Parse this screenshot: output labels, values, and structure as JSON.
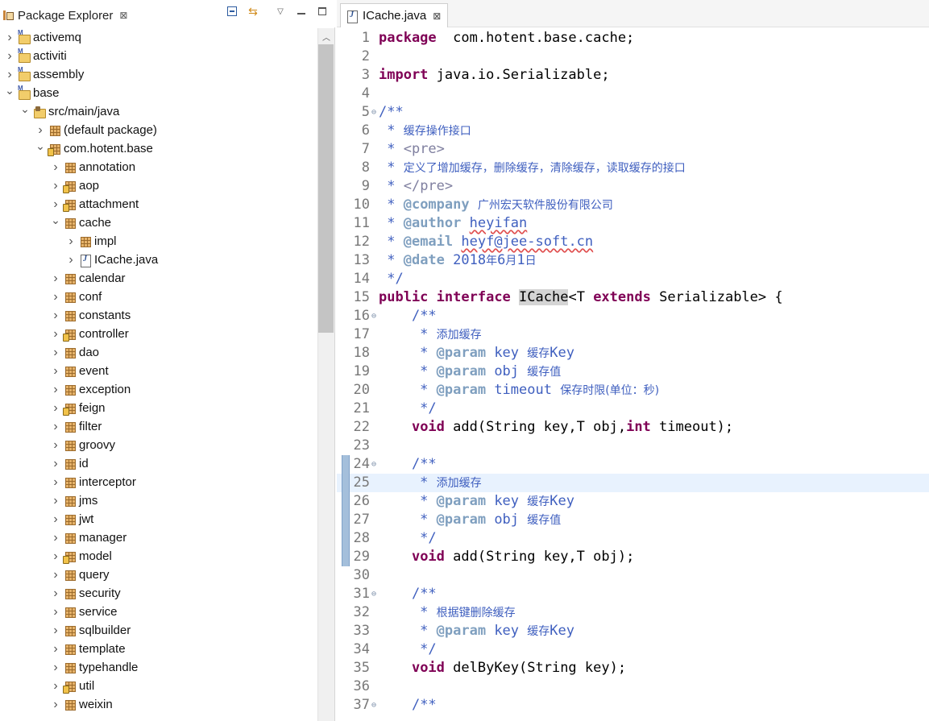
{
  "package_explorer": {
    "title": "Package Explorer",
    "close_glyph": "⊠",
    "tree": [
      {
        "label": "activemq",
        "depth": 0,
        "expanded": false,
        "icon": "project-icon"
      },
      {
        "label": "activiti",
        "depth": 0,
        "expanded": false,
        "icon": "project-icon"
      },
      {
        "label": "assembly",
        "depth": 0,
        "expanded": false,
        "icon": "project-icon"
      },
      {
        "label": "base",
        "depth": 0,
        "expanded": true,
        "icon": "project-icon"
      },
      {
        "label": "src/main/java",
        "depth": 1,
        "expanded": true,
        "icon": "source-folder-icon"
      },
      {
        "label": "(default package)",
        "depth": 2,
        "expanded": false,
        "icon": "package-icon"
      },
      {
        "label": "com.hotent.base",
        "depth": 2,
        "expanded": true,
        "icon": "package-decorated-icon"
      },
      {
        "label": "annotation",
        "depth": 3,
        "expanded": false,
        "icon": "package-icon"
      },
      {
        "label": "aop",
        "depth": 3,
        "expanded": false,
        "icon": "package-decorated-icon"
      },
      {
        "label": "attachment",
        "depth": 3,
        "expanded": false,
        "icon": "package-decorated-icon"
      },
      {
        "label": "cache",
        "depth": 3,
        "expanded": true,
        "icon": "package-icon"
      },
      {
        "label": "impl",
        "depth": 4,
        "expanded": false,
        "icon": "package-icon"
      },
      {
        "label": "ICache.java",
        "depth": 4,
        "expanded": false,
        "icon": "java-file-icon"
      },
      {
        "label": "calendar",
        "depth": 3,
        "expanded": false,
        "icon": "package-icon"
      },
      {
        "label": "conf",
        "depth": 3,
        "expanded": false,
        "icon": "package-icon"
      },
      {
        "label": "constants",
        "depth": 3,
        "expanded": false,
        "icon": "package-icon"
      },
      {
        "label": "controller",
        "depth": 3,
        "expanded": false,
        "icon": "package-decorated-icon"
      },
      {
        "label": "dao",
        "depth": 3,
        "expanded": false,
        "icon": "package-icon"
      },
      {
        "label": "event",
        "depth": 3,
        "expanded": false,
        "icon": "package-icon"
      },
      {
        "label": "exception",
        "depth": 3,
        "expanded": false,
        "icon": "package-icon"
      },
      {
        "label": "feign",
        "depth": 3,
        "expanded": false,
        "icon": "package-decorated-icon"
      },
      {
        "label": "filter",
        "depth": 3,
        "expanded": false,
        "icon": "package-icon"
      },
      {
        "label": "groovy",
        "depth": 3,
        "expanded": false,
        "icon": "package-icon"
      },
      {
        "label": "id",
        "depth": 3,
        "expanded": false,
        "icon": "package-icon"
      },
      {
        "label": "interceptor",
        "depth": 3,
        "expanded": false,
        "icon": "package-icon"
      },
      {
        "label": "jms",
        "depth": 3,
        "expanded": false,
        "icon": "package-icon"
      },
      {
        "label": "jwt",
        "depth": 3,
        "expanded": false,
        "icon": "package-icon"
      },
      {
        "label": "manager",
        "depth": 3,
        "expanded": false,
        "icon": "package-icon"
      },
      {
        "label": "model",
        "depth": 3,
        "expanded": false,
        "icon": "package-decorated-icon"
      },
      {
        "label": "query",
        "depth": 3,
        "expanded": false,
        "icon": "package-icon"
      },
      {
        "label": "security",
        "depth": 3,
        "expanded": false,
        "icon": "package-icon"
      },
      {
        "label": "service",
        "depth": 3,
        "expanded": false,
        "icon": "package-icon"
      },
      {
        "label": "sqlbuilder",
        "depth": 3,
        "expanded": false,
        "icon": "package-icon"
      },
      {
        "label": "template",
        "depth": 3,
        "expanded": false,
        "icon": "package-icon"
      },
      {
        "label": "typehandle",
        "depth": 3,
        "expanded": false,
        "icon": "package-icon"
      },
      {
        "label": "util",
        "depth": 3,
        "expanded": false,
        "icon": "package-decorated-icon"
      },
      {
        "label": "weixin",
        "depth": 3,
        "expanded": false,
        "icon": "package-icon"
      }
    ]
  },
  "editor": {
    "tab_label": "ICache.java",
    "close_glyph": "⊠",
    "current_line": 25,
    "changed_lines": [
      24,
      25,
      26,
      27,
      28,
      29
    ],
    "lines": [
      {
        "n": 1,
        "segs": [
          [
            "kw",
            "package"
          ],
          [
            "",
            "  com.hotent.base.cache;"
          ]
        ]
      },
      {
        "n": 2,
        "segs": []
      },
      {
        "n": 3,
        "segs": [
          [
            "kw",
            "import"
          ],
          [
            "",
            " java.io.Serializable;"
          ]
        ]
      },
      {
        "n": 4,
        "segs": []
      },
      {
        "n": 5,
        "fold": true,
        "segs": [
          [
            "cm",
            "/**"
          ]
        ]
      },
      {
        "n": 6,
        "segs": [
          [
            "cm",
            " * "
          ],
          [
            "cm cjk",
            "缓存操作接口"
          ]
        ]
      },
      {
        "n": 7,
        "segs": [
          [
            "cm",
            " * "
          ],
          [
            "cm-html",
            "<pre>"
          ]
        ]
      },
      {
        "n": 8,
        "segs": [
          [
            "cm",
            " * "
          ],
          [
            "cm cjk",
            "定义了增加缓存，删除缓存，清除缓存，读取缓存的接口"
          ]
        ]
      },
      {
        "n": 9,
        "segs": [
          [
            "cm",
            " * "
          ],
          [
            "cm-html",
            "</pre>"
          ]
        ]
      },
      {
        "n": 10,
        "segs": [
          [
            "cm",
            " * "
          ],
          [
            "cm-tag",
            "@company"
          ],
          [
            "cm",
            " "
          ],
          [
            "cm cjk",
            "广州宏天软件股份有限公司"
          ]
        ]
      },
      {
        "n": 11,
        "segs": [
          [
            "cm",
            " * "
          ],
          [
            "cm-tag",
            "@author"
          ],
          [
            "cm",
            " "
          ],
          [
            "cm squiggle",
            "heyifan"
          ]
        ]
      },
      {
        "n": 12,
        "segs": [
          [
            "cm",
            " * "
          ],
          [
            "cm-tag",
            "@email"
          ],
          [
            "cm",
            " "
          ],
          [
            "cm squiggle",
            "heyf@jee-soft.cn"
          ]
        ]
      },
      {
        "n": 13,
        "segs": [
          [
            "cm",
            " * "
          ],
          [
            "cm-tag",
            "@date"
          ],
          [
            "cm",
            " 2018"
          ],
          [
            "cm cjk",
            "年"
          ],
          [
            "cm",
            "6"
          ],
          [
            "cm cjk",
            "月"
          ],
          [
            "cm",
            "1"
          ],
          [
            "cm cjk",
            "日"
          ]
        ]
      },
      {
        "n": 14,
        "segs": [
          [
            "cm",
            " */"
          ]
        ]
      },
      {
        "n": 15,
        "segs": [
          [
            "kw",
            "public"
          ],
          [
            "",
            " "
          ],
          [
            "kw",
            "interface"
          ],
          [
            "",
            " "
          ],
          [
            "hl-sel",
            "ICache"
          ],
          [
            "",
            "<T "
          ],
          [
            "kw",
            "extends"
          ],
          [
            "",
            " Serializable> {"
          ]
        ]
      },
      {
        "n": 16,
        "fold": true,
        "segs": [
          [
            "",
            "    "
          ],
          [
            "cm",
            "/**"
          ]
        ]
      },
      {
        "n": 17,
        "segs": [
          [
            "cm",
            "     * "
          ],
          [
            "cm cjk",
            "添加缓存"
          ]
        ]
      },
      {
        "n": 18,
        "segs": [
          [
            "cm",
            "     * "
          ],
          [
            "cm-tag",
            "@param"
          ],
          [
            "cm",
            " key "
          ],
          [
            "cm cjk",
            "缓存"
          ],
          [
            "cm",
            "Key"
          ]
        ]
      },
      {
        "n": 19,
        "segs": [
          [
            "cm",
            "     * "
          ],
          [
            "cm-tag",
            "@param"
          ],
          [
            "cm",
            " obj "
          ],
          [
            "cm cjk",
            "缓存值"
          ]
        ]
      },
      {
        "n": 20,
        "segs": [
          [
            "cm",
            "     * "
          ],
          [
            "cm-tag",
            "@param"
          ],
          [
            "cm",
            " timeout "
          ],
          [
            "cm cjk",
            "保存时限(单位：秒)"
          ]
        ]
      },
      {
        "n": 21,
        "segs": [
          [
            "cm",
            "     */"
          ]
        ]
      },
      {
        "n": 22,
        "segs": [
          [
            "",
            "    "
          ],
          [
            "kw",
            "void"
          ],
          [
            "",
            " add(String key,T obj,"
          ],
          [
            "kw",
            "int"
          ],
          [
            "",
            " timeout);"
          ]
        ]
      },
      {
        "n": 23,
        "segs": []
      },
      {
        "n": 24,
        "fold": true,
        "segs": [
          [
            "",
            "    "
          ],
          [
            "cm",
            "/**"
          ]
        ]
      },
      {
        "n": 25,
        "segs": [
          [
            "cm",
            "     * "
          ],
          [
            "cm cjk",
            "添加缓存"
          ]
        ]
      },
      {
        "n": 26,
        "segs": [
          [
            "cm",
            "     * "
          ],
          [
            "cm-tag",
            "@param"
          ],
          [
            "cm",
            " key "
          ],
          [
            "cm cjk",
            "缓存"
          ],
          [
            "cm",
            "Key"
          ]
        ]
      },
      {
        "n": 27,
        "segs": [
          [
            "cm",
            "     * "
          ],
          [
            "cm-tag",
            "@param"
          ],
          [
            "cm",
            " obj "
          ],
          [
            "cm cjk",
            "缓存值"
          ]
        ]
      },
      {
        "n": 28,
        "segs": [
          [
            "cm",
            "     */"
          ]
        ]
      },
      {
        "n": 29,
        "segs": [
          [
            "",
            "    "
          ],
          [
            "kw",
            "void"
          ],
          [
            "",
            " add(String key,T obj);"
          ]
        ]
      },
      {
        "n": 30,
        "segs": []
      },
      {
        "n": 31,
        "fold": true,
        "segs": [
          [
            "",
            "    "
          ],
          [
            "cm",
            "/**"
          ]
        ]
      },
      {
        "n": 32,
        "segs": [
          [
            "cm",
            "     * "
          ],
          [
            "cm cjk",
            "根据键删除缓存"
          ]
        ]
      },
      {
        "n": 33,
        "segs": [
          [
            "cm",
            "     * "
          ],
          [
            "cm-tag",
            "@param"
          ],
          [
            "cm",
            " key "
          ],
          [
            "cm cjk",
            "缓存"
          ],
          [
            "cm",
            "Key"
          ]
        ]
      },
      {
        "n": 34,
        "segs": [
          [
            "cm",
            "     */"
          ]
        ]
      },
      {
        "n": 35,
        "segs": [
          [
            "",
            "    "
          ],
          [
            "kw",
            "void"
          ],
          [
            "",
            " delByKey(String key);"
          ]
        ]
      },
      {
        "n": 36,
        "segs": []
      },
      {
        "n": 37,
        "fold": true,
        "segs": [
          [
            "",
            "    "
          ],
          [
            "cm",
            "/**"
          ]
        ]
      }
    ]
  }
}
